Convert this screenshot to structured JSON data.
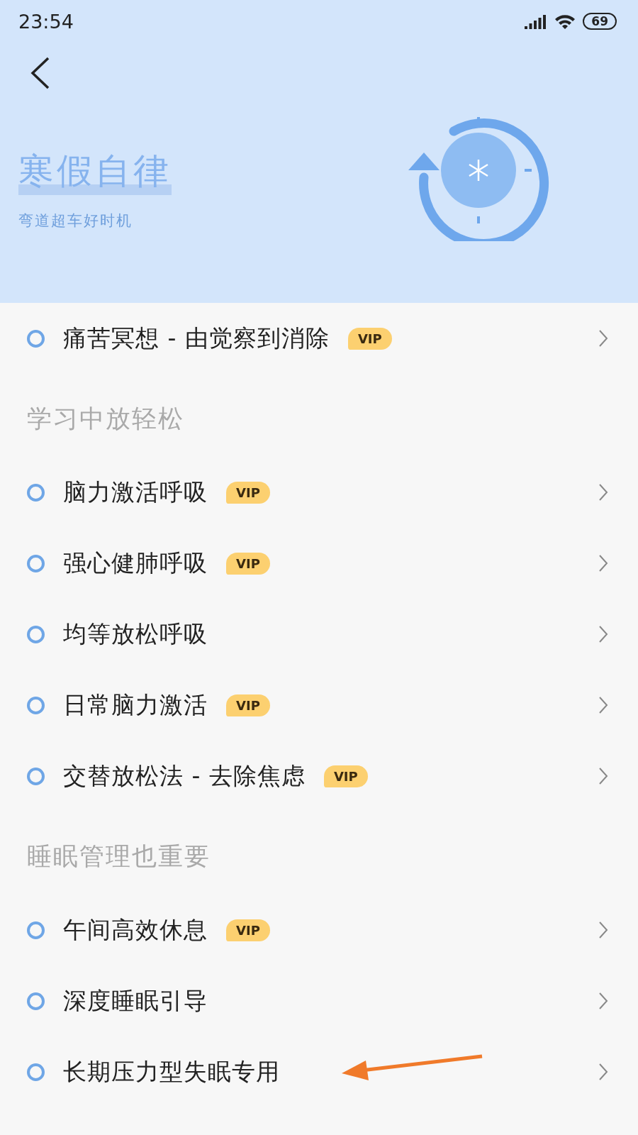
{
  "status_bar": {
    "time": "23:54",
    "battery": "69"
  },
  "header": {
    "title": "寒假自律",
    "subtitle": "弯道超车好时机"
  },
  "sections": [
    {
      "items": [
        {
          "label": "痛苦冥想 - 由觉察到消除",
          "badge": "VIP"
        }
      ]
    },
    {
      "title": "学习中放轻松",
      "items": [
        {
          "label": "脑力激活呼吸",
          "badge": "VIP"
        },
        {
          "label": "强心健肺呼吸",
          "badge": "VIP"
        },
        {
          "label": "均等放松呼吸"
        },
        {
          "label": "日常脑力激活",
          "badge": "VIP"
        },
        {
          "label": "交替放松法 - 去除焦虑",
          "badge": "VIP"
        }
      ]
    },
    {
      "title": "睡眠管理也重要",
      "items": [
        {
          "label": "午间高效休息",
          "badge": "VIP"
        },
        {
          "label": "深度睡眠引导"
        },
        {
          "label": "长期压力型失眠专用",
          "highlighted": true
        }
      ]
    }
  ]
}
